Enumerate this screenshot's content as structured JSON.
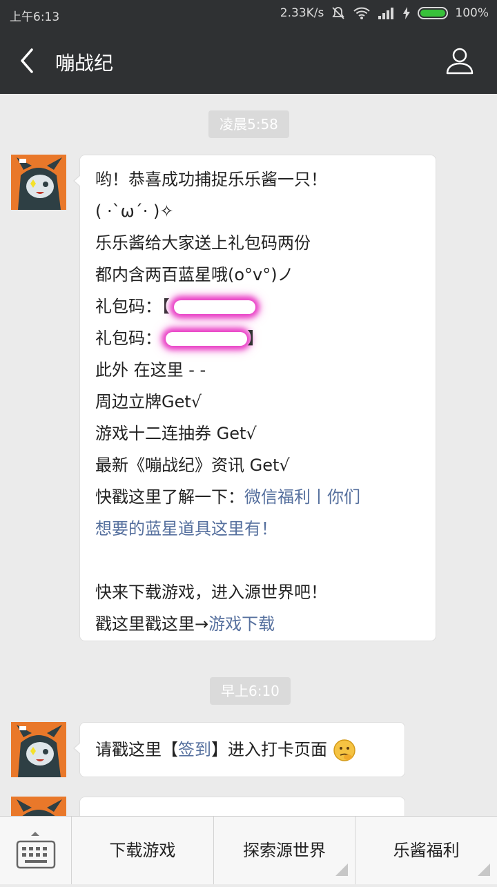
{
  "status_bar": {
    "time": "上午6:13",
    "net_speed": "2.33K/s",
    "battery": "100%"
  },
  "nav": {
    "title": "嘣战纪",
    "back_icon": "chevron-left-icon",
    "profile_icon": "person-icon"
  },
  "chat": {
    "messages": [
      {
        "timestamp": "凌晨5:58",
        "lines": [
          {
            "text": "哟！恭喜成功捕捉乐乐酱一只！"
          },
          {
            "text": "( ·`ω´· )✧"
          },
          {
            "text": "乐乐酱给大家送上礼包码两份"
          },
          {
            "text": "都内含两百蓝星哦(o°v°)ノ"
          },
          {
            "label": "礼包码：",
            "redacted": true
          },
          {
            "label": "礼包码：",
            "redacted": true
          },
          {
            "text": "此外 在这里 - -"
          },
          {
            "text": "周边立牌Get√"
          },
          {
            "text": "游戏十二连抽券 Get√"
          },
          {
            "text": "最新《嘣战纪》资讯 Get√"
          },
          {
            "text": "快戳这里了解一下：",
            "link": "微信福利丨你们"
          },
          {
            "link": "想要的蓝星道具这里有！"
          },
          {
            "text": ""
          },
          {
            "text": "快来下载游戏，进入源世界吧！"
          },
          {
            "text": "戳这里戳这里→",
            "link": "游戏下载"
          }
        ]
      },
      {
        "timestamp": "早上6:10",
        "prefix": "请戳这里【",
        "link": "签到",
        "suffix": "】进入打卡页面"
      }
    ]
  },
  "bottom_menu": {
    "keyboard_icon": "keyboard-icon",
    "items": [
      "下载游戏",
      "探索源世界",
      "乐酱福利"
    ]
  }
}
